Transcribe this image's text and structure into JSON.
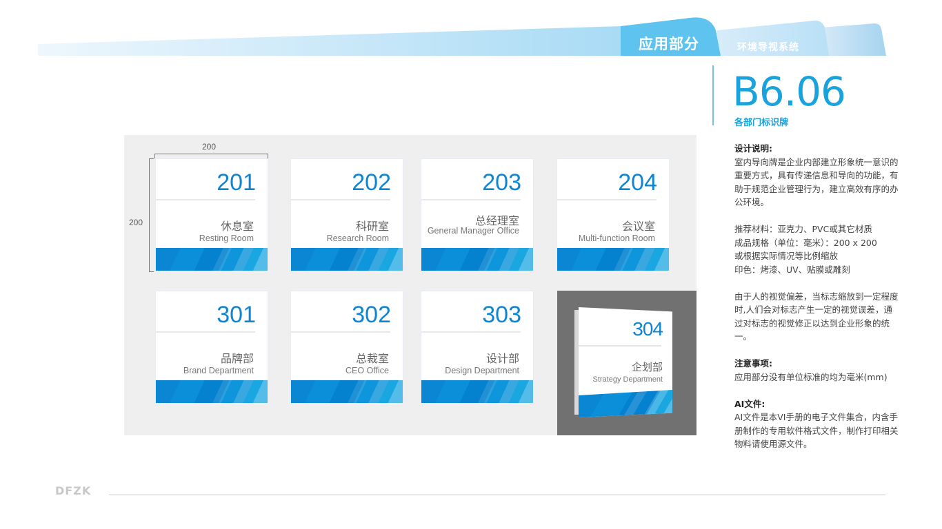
{
  "header": {
    "section_title": "应用部分",
    "section_subtitle": "环境导视系统"
  },
  "page": {
    "code": "B6.06",
    "title": "各部门标识牌"
  },
  "info": {
    "design_heading": "设计说明:",
    "design_text": "室内导向牌是企业内部建立形象统一意识的重要方式，具有传递信息和导向的功能，有助于规范企业管理行为，建立高效有序的办公环境。",
    "materials": "推荐材料：亚克力、PVC或其它材质",
    "spec": "成品规格（单位：毫米）：200 x 200",
    "scale": "或根据实际情况等比例缩放",
    "printing": "印色：烤漆、UV、贴膜或雕刻",
    "visual_text": "由于人的视觉偏差，当标志缩放到一定程度时,人们会对标志产生一定的视觉误差，通过对标志的视觉修正以达到企业形象的统一。",
    "notes_heading": "注意事项:",
    "notes_text": "应用部分没有单位标准的均为毫米(mm)",
    "ai_heading": "AI文件:",
    "ai_text": "AI文件是本VI手册的电子文件集合，内含手册制作的专用软件格式文件，制作打印相关物料请使用源文件。"
  },
  "dimensions": {
    "width": "200",
    "height": "200"
  },
  "signs": [
    {
      "number": "201",
      "cn": "休息室",
      "en": "Resting Room"
    },
    {
      "number": "202",
      "cn": "科研室",
      "en": "Research Room"
    },
    {
      "number": "203",
      "cn": "总经理室",
      "en": "General Manager Office"
    },
    {
      "number": "204",
      "cn": "会议室",
      "en": "Multi-function Room"
    },
    {
      "number": "301",
      "cn": "品牌部",
      "en": "Brand Department"
    },
    {
      "number": "302",
      "cn": "总裁室",
      "en": "CEO Office"
    },
    {
      "number": "303",
      "cn": "设计部",
      "en": "Design Department"
    },
    {
      "number": "304",
      "cn": "企划部",
      "en": "Strategy Department"
    }
  ],
  "footer": {
    "logo": "DFZK"
  },
  "colors": {
    "accent": "#1aa2dc",
    "sign_number": "#0e85d2",
    "stripe": "#0a86d3",
    "panel": "#efefef",
    "photo_bg": "#727171"
  }
}
